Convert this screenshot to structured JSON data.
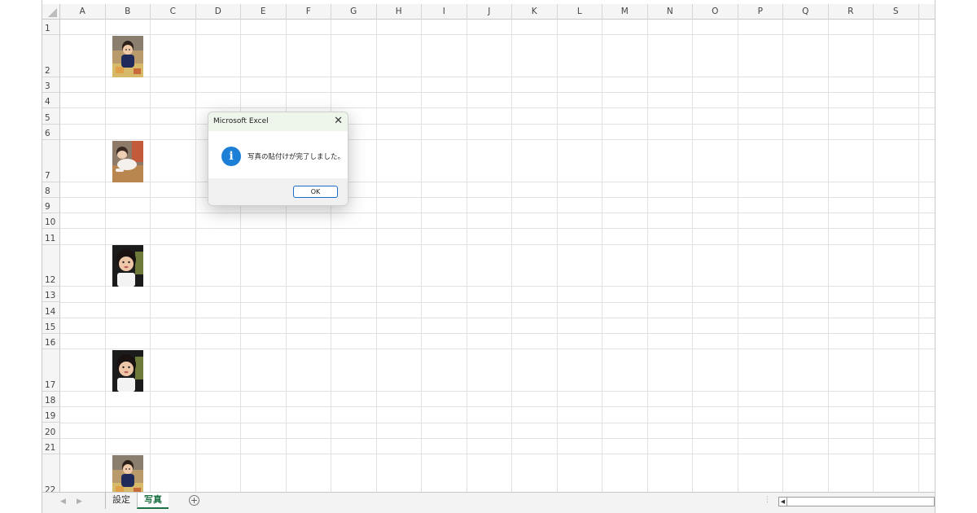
{
  "columns": [
    "A",
    "B",
    "C",
    "D",
    "E",
    "F",
    "G",
    "H",
    "I",
    "J",
    "K",
    "L",
    "M",
    "N",
    "O",
    "P",
    "Q",
    "R",
    "S"
  ],
  "rows": [
    "1",
    "2",
    "3",
    "4",
    "5",
    "6",
    "7",
    "8",
    "9",
    "10",
    "11",
    "12",
    "13",
    "14",
    "15",
    "16",
    "17",
    "18",
    "19",
    "20",
    "21",
    "22"
  ],
  "photos": [
    {
      "row": "2",
      "kind": "sitting-toddler-colorful"
    },
    {
      "row": "7",
      "kind": "crawling-baby"
    },
    {
      "row": "12",
      "kind": "baby-portrait"
    },
    {
      "row": "17",
      "kind": "baby-portrait"
    },
    {
      "row": "22",
      "kind": "sitting-toddler-colorful"
    }
  ],
  "sheet_tabs": [
    {
      "label": "設定",
      "active": false
    },
    {
      "label": "写真",
      "active": true
    }
  ],
  "dialog": {
    "title": "Microsoft Excel",
    "message": "写真の貼付けが完了しました。",
    "ok_label": "OK",
    "icon": "info-icon",
    "close_icon": "close-icon"
  },
  "colors": {
    "accent_green": "#1e7145",
    "info_blue": "#1e7fd7",
    "dialog_title_bg": "#eef6ec"
  }
}
